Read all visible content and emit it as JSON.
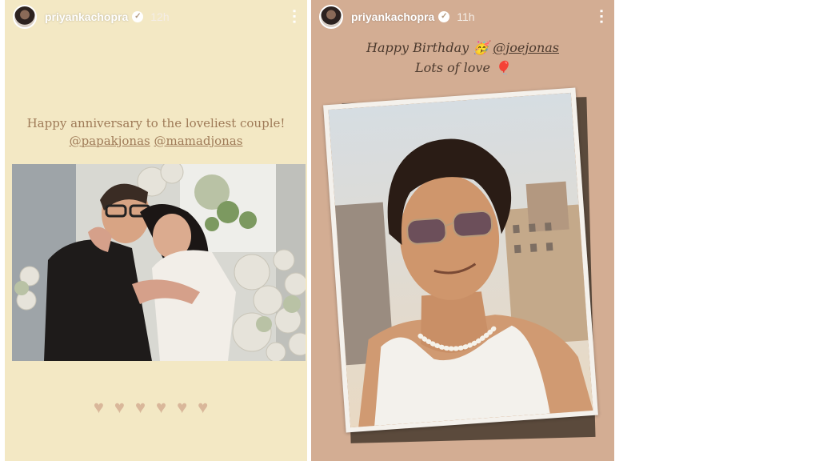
{
  "stories": [
    {
      "username": "priyankachopra",
      "verified_icon": "verified-badge-icon",
      "time": "12h",
      "caption_line1": "Happy anniversary to the loveliest couple!",
      "mention1": "@papakjonas",
      "mention2": "@mamadjonas",
      "hearts": "♥♥♥♥♥♥",
      "photo_icon": "couple-photo"
    },
    {
      "username": "priyankachopra",
      "verified_icon": "verified-badge-icon",
      "time": "11h",
      "caption_prefix": "Happy Birthday",
      "emoji1": "🥳",
      "mention": "@joejonas",
      "caption_line2": "Lots of love",
      "emoji2": "🎈",
      "photo_icon": "portrait-photo"
    }
  ],
  "colors": {
    "story1_bg": "#f3e8c4",
    "story2_bg": "#d3ad93",
    "frame_dark": "#5b4a3c"
  }
}
